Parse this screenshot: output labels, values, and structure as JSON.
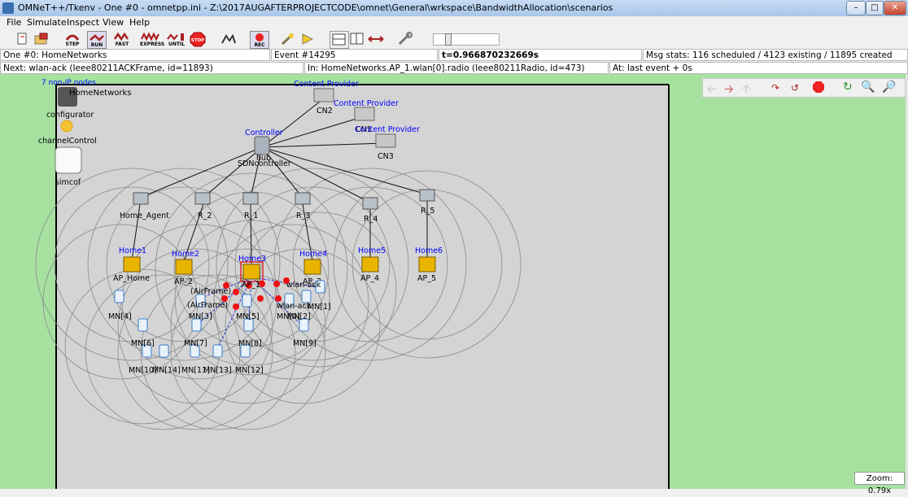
{
  "window": {
    "title": "OMNeT++/Tkenv - One #0 - omnetpp.ini - Z:\\2017AUGAFTERPROJECTCODE\\omnet\\General\\wrkspace\\BandwidthAllocation\\scenarios"
  },
  "menu": [
    "File",
    "Simulate",
    "Inspect",
    "View",
    "Help"
  ],
  "toolbar": {
    "step": "STEP",
    "run": "RUN",
    "fast": "FAST",
    "express": "EXPRESS",
    "until": "UNTIL",
    "stop": "STOP",
    "rec": "REC"
  },
  "status": {
    "run": "One #0: HomeNetworks",
    "event": "Event #14295",
    "time": "t=0.966870232669s",
    "msgstats": "Msg stats: 116 scheduled / 4123 existing / 11895 created",
    "next": "Next: wlan-ack (Ieee80211ACKFrame, id=11893)",
    "in": "In: HomeNetworks.AP_1.wlan[0].radio (Ieee80211Radio, id=473)",
    "at": "At: last event + 0s"
  },
  "network": {
    "nonip": "7 non-IP nodes",
    "name": "HomeNetworks",
    "configurator": "configurator",
    "channelControl": "channelControl",
    "simcof": "simcof",
    "cp1_caption": "Content Provider",
    "cp2_caption": "Content Provider",
    "cp3_caption": "Content Provider",
    "cn2": "CN2",
    "cn1": "CN1",
    "cn3": "CN3",
    "controller_caption": "Controller",
    "hub": "hub",
    "sdn": "SDNcontroller",
    "routers": [
      "Home_Agent",
      "R_2",
      "R_1",
      "R_3",
      "R_4",
      "R_5"
    ],
    "home_captions": [
      "Home1",
      "Home2",
      "Home3",
      "Home4",
      "Home5",
      "Home6"
    ],
    "aps": [
      "AP_Home",
      "AP_2",
      "AP_1",
      "AP_3",
      "AP_4",
      "AP_5"
    ],
    "mns": [
      "MN[4]",
      "MN[3]",
      "MN[5]",
      "MN[0]",
      "MN[1]",
      "MN[2]",
      "MN[6]",
      "MN[7]",
      "MN[8]",
      "MN[9]",
      "MN[10]",
      "MN[14]",
      "MN[11]",
      "MN[13]",
      "MN[12]"
    ],
    "msg1": "(AirFrame)",
    "msg2": "wlan-ack",
    "msg3": "(AirFrame)",
    "msg4": "wlan-ack"
  },
  "zoom": "Zoom: 0.79x",
  "colors": {
    "canvas_bg": "#a6e1a0",
    "network_bg": "#d4d4d4",
    "caption": "#0000ff",
    "message": "#ff0000"
  }
}
